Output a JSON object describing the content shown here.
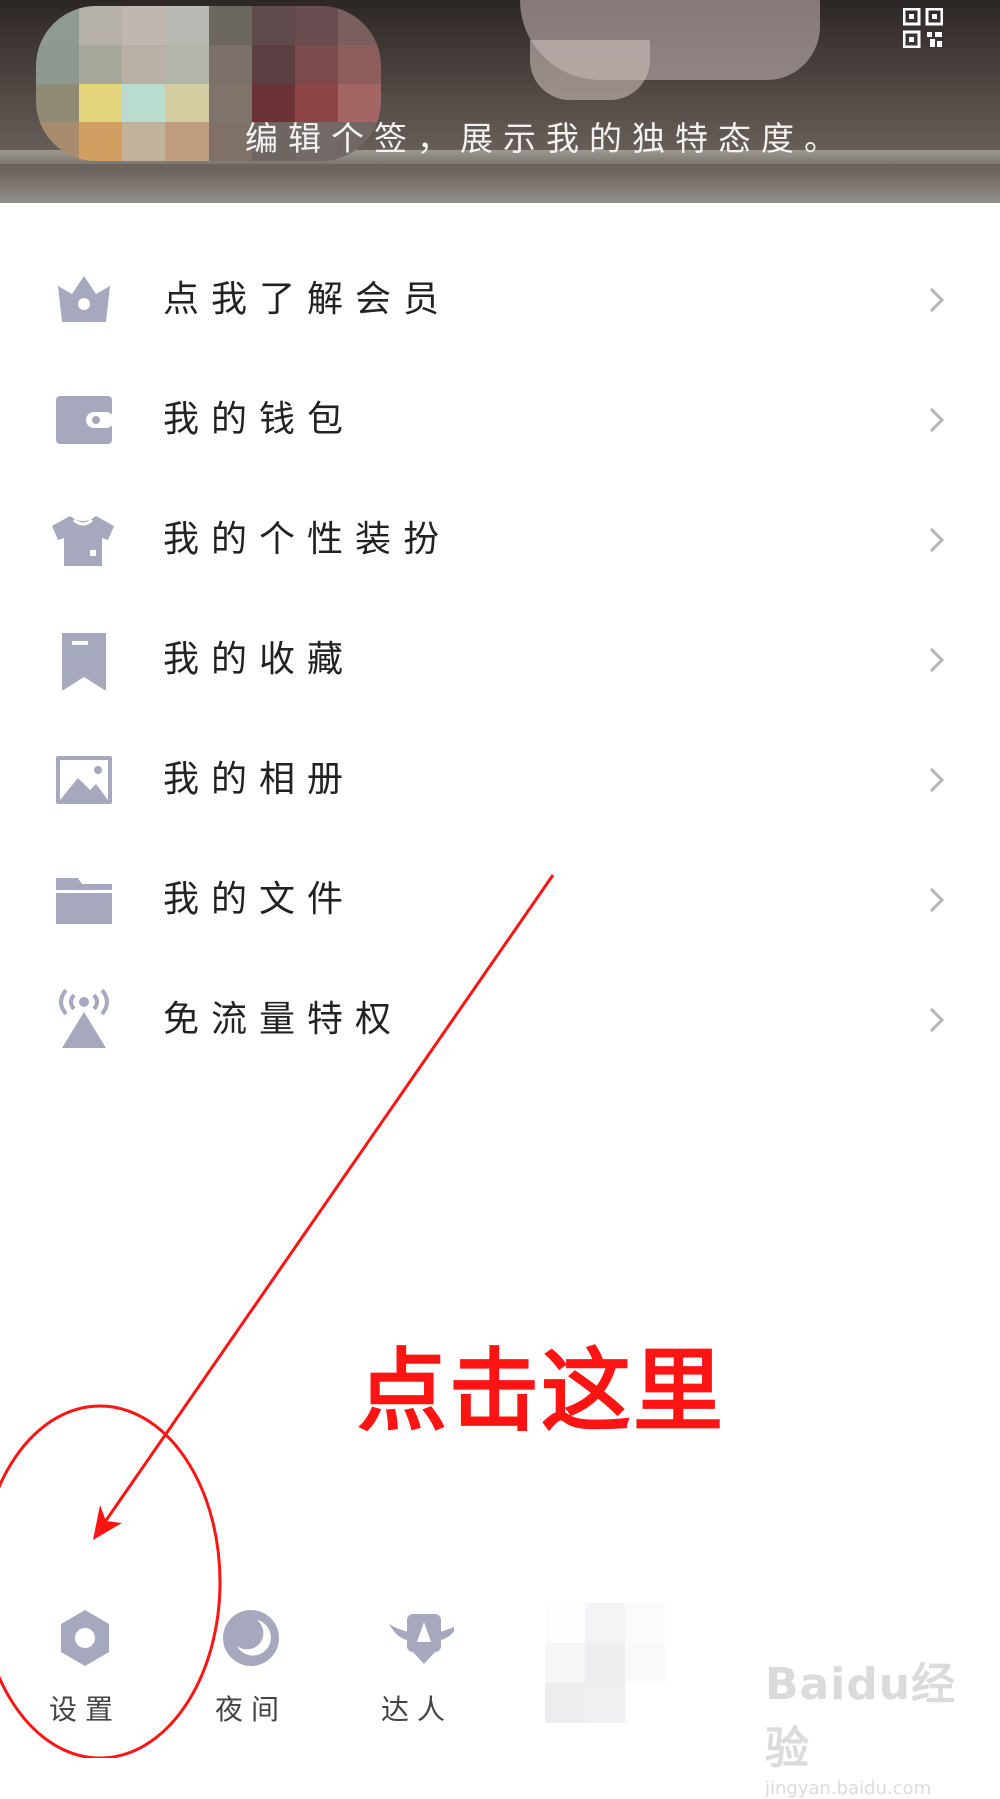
{
  "header": {
    "signature": "编辑个签，展示我的独特态度。",
    "qr_icon": "qr-code-icon"
  },
  "menu": {
    "items": [
      {
        "label": "点我了解会员",
        "icon": "crown-icon"
      },
      {
        "label": "我的钱包",
        "icon": "wallet-icon"
      },
      {
        "label": "我的个性装扮",
        "icon": "tshirt-icon"
      },
      {
        "label": "我的收藏",
        "icon": "bookmark-icon"
      },
      {
        "label": "我的相册",
        "icon": "photo-icon"
      },
      {
        "label": "我的文件",
        "icon": "folder-icon"
      },
      {
        "label": "免流量特权",
        "icon": "signal-tower-icon"
      }
    ]
  },
  "annotation": {
    "text": "点击这里",
    "color": "#ff1414"
  },
  "bottom_bar": {
    "tabs": [
      {
        "label": "设置",
        "icon": "settings-icon"
      },
      {
        "label": "夜间",
        "icon": "moon-icon"
      },
      {
        "label": "达人",
        "icon": "expert-icon"
      }
    ]
  },
  "watermark": {
    "logo": "Baidu经验",
    "url": "jingyan.baidu.com"
  },
  "colors": {
    "icon": "#a6a8bd",
    "chevron": "#b5b5b5",
    "text": "#222222"
  }
}
